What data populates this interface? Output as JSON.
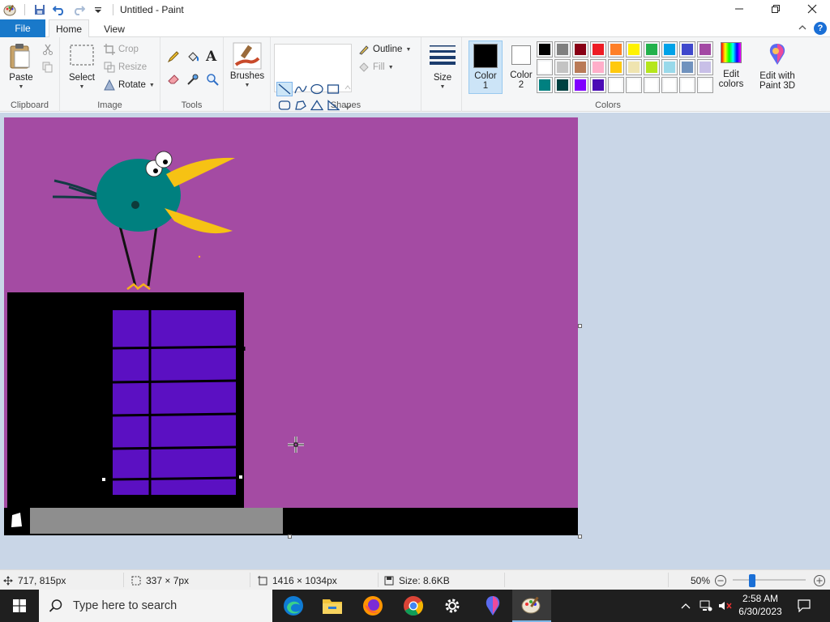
{
  "window": {
    "title": "Untitled - Paint"
  },
  "tabs": {
    "file": "File",
    "home": "Home",
    "view": "View"
  },
  "clipboard": {
    "paste": "Paste",
    "label": "Clipboard"
  },
  "image": {
    "select": "Select",
    "crop": "Crop",
    "resize": "Resize",
    "rotate": "Rotate",
    "label": "Image"
  },
  "tools": {
    "label": "Tools"
  },
  "brushes": {
    "label": "Brushes"
  },
  "shapes": {
    "outline": "Outline",
    "fill": "Fill",
    "label": "Shapes"
  },
  "size": {
    "label": "Size"
  },
  "colors": {
    "color1_label": "Color",
    "color1_num": "1",
    "color2_label": "Color",
    "color2_num": "2",
    "color1_value": "#000000",
    "color2_value": "#ffffff",
    "edit_label_1": "Edit",
    "edit_label_2": "colors",
    "paint3d_1": "Edit with",
    "paint3d_2": "Paint 3D",
    "label": "Colors",
    "palette": [
      "#000000",
      "#7f7f7f",
      "#880015",
      "#ed1c24",
      "#ff7f27",
      "#fff200",
      "#22b14c",
      "#00a2e8",
      "#3f48cc",
      "#a349a4",
      "#ffffff",
      "#c3c3c3",
      "#b97a57",
      "#ffaec9",
      "#ffc90e",
      "#efe4b0",
      "#b5e61d",
      "#99d9ea",
      "#7092be",
      "#c8bfe7",
      "#008080",
      "#004040",
      "#8000ff",
      "#4b0bb5",
      "#ffffff",
      "#ffffff",
      "#ffffff",
      "#ffffff",
      "#ffffff",
      "#ffffff"
    ]
  },
  "canvas": {
    "background": "#a44ba3"
  },
  "status": {
    "cursor_pos": "717, 815px",
    "selection_size": "337 × 7px",
    "image_size": "1416 × 1034px",
    "file_size": "Size: 8.6KB",
    "zoom": "50%",
    "zoom_level": 0.5
  },
  "taskbar": {
    "search_placeholder": "Type here to search",
    "time": "2:58 AM",
    "date": "6/30/2023"
  }
}
